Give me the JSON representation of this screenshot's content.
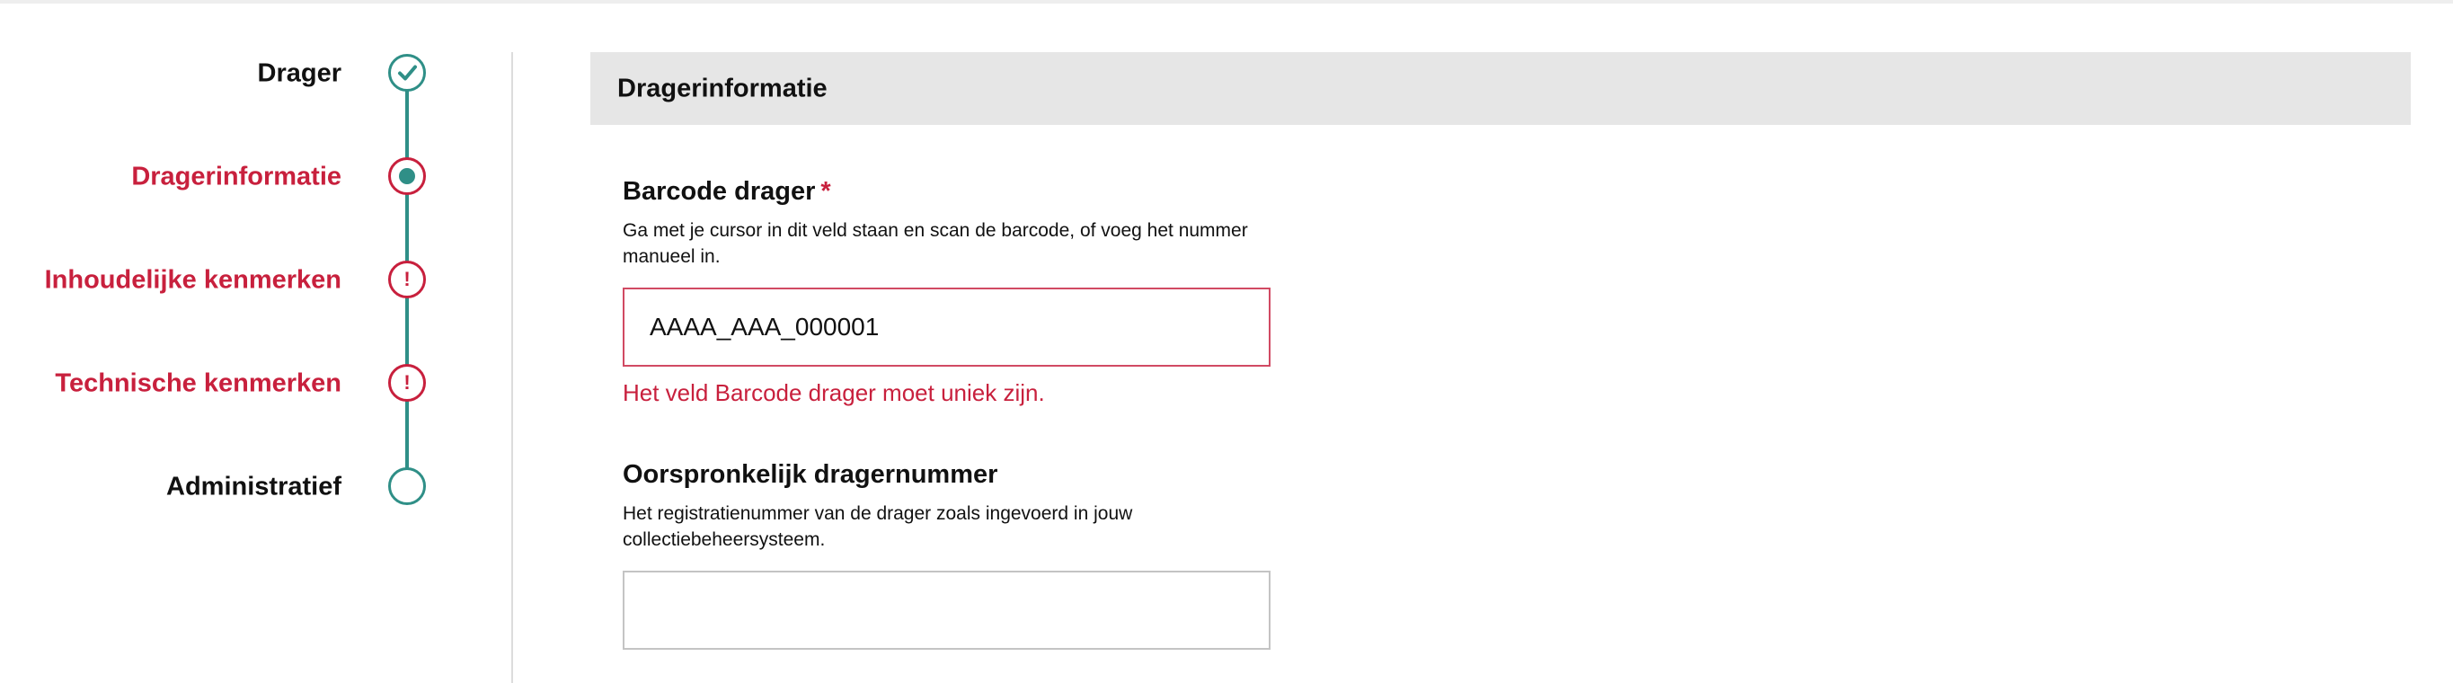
{
  "stepper": {
    "steps": [
      {
        "label": "Drager",
        "state": "completed",
        "icon": "check-icon"
      },
      {
        "label": "Dragerinformatie",
        "state": "current",
        "icon": "dot-icon"
      },
      {
        "label": "Inhoudelijke kenmerken",
        "state": "error",
        "icon": "exclamation-icon",
        "icon_text": "!"
      },
      {
        "label": "Technische kenmerken",
        "state": "error",
        "icon": "exclamation-icon",
        "icon_text": "!"
      },
      {
        "label": "Administratief",
        "state": "pending",
        "icon": "empty-circle-icon"
      }
    ]
  },
  "section": {
    "title": "Dragerinformatie"
  },
  "fields": {
    "barcode": {
      "label": "Barcode drager",
      "required_mark": "*",
      "help": "Ga met je cursor in dit veld staan en scan de barcode, of voeg het nummer manueel in.",
      "value": "AAAA_AAA_000001",
      "placeholder": "",
      "error": "Het veld Barcode drager moet uniek zijn."
    },
    "original_number": {
      "label": "Oorspronkelijk dragernummer",
      "help": "Het registratienummer van de drager zoals ingevoerd in jouw collectiebeheersysteem.",
      "value": "",
      "placeholder": ""
    }
  },
  "colors": {
    "teal": "#2f8f87",
    "red": "#c8203d",
    "header_bg": "#e6e6e6"
  }
}
